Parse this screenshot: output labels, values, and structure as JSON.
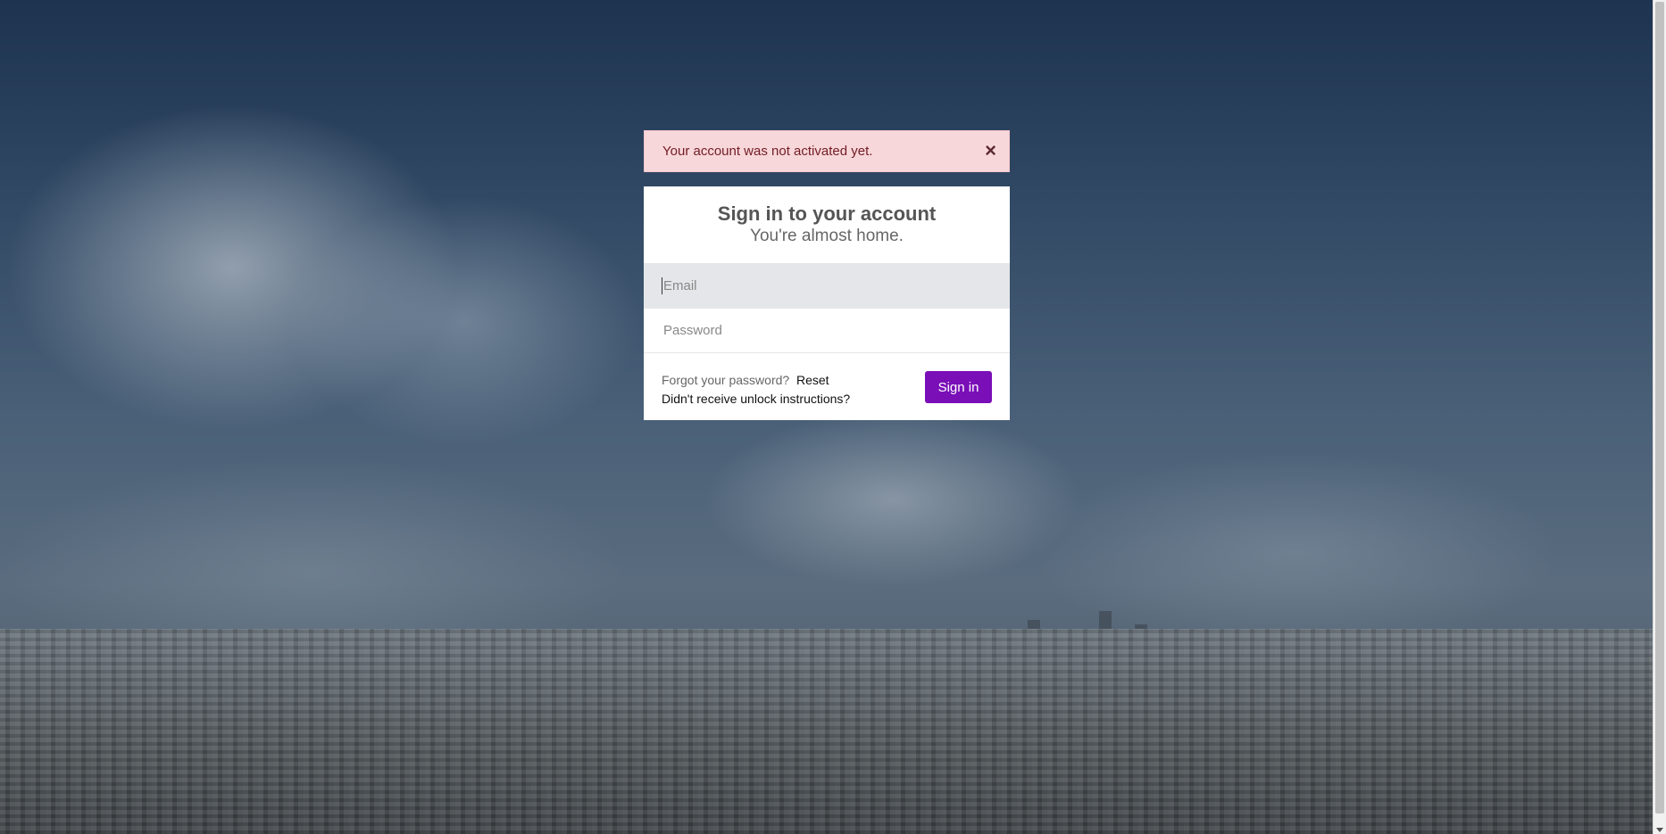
{
  "alert": {
    "message": "Your account was not activated yet.",
    "close_symbol": "×",
    "background_color": "#f8d7da",
    "text_color": "#721c24"
  },
  "card": {
    "title": "Sign in to your account",
    "subtitle": "You're almost home."
  },
  "form": {
    "email_placeholder": "Email",
    "email_value": "",
    "password_placeholder": "Password",
    "password_value": "",
    "forgot_prompt": "Forgot your password?",
    "reset_link": "Reset",
    "unlock_link": "Didn't receive unlock instructions?",
    "submit_label": "Sign in",
    "submit_color": "#7a0fb8"
  }
}
